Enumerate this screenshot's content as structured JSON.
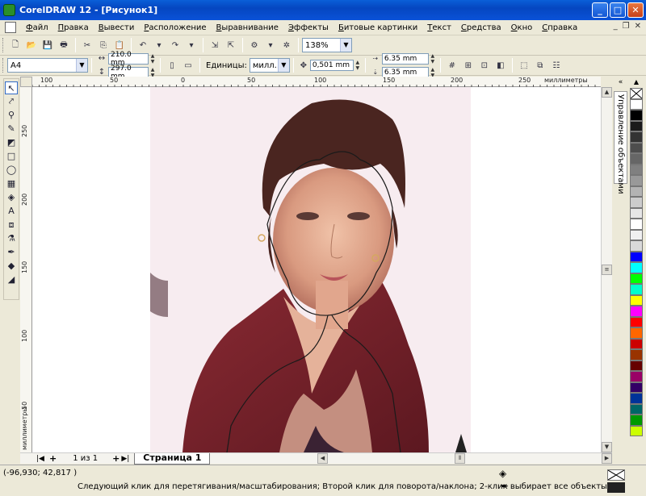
{
  "window": {
    "title": "CorelDRAW 12 - [Рисунок1]",
    "buttons": [
      "_",
      "□",
      "✕"
    ]
  },
  "menu": [
    "Файл",
    "Правка",
    "Вывести",
    "Расположение",
    "Выравнивание",
    "Эффекты",
    "Битовые картинки",
    "Текст",
    "Средства",
    "Окно",
    "Справка"
  ],
  "toolbar": {
    "zoom": "138%"
  },
  "property_bar": {
    "paper": "A4",
    "width": "210.0 mm",
    "height": "297.0 mm",
    "units_label": "Единицы:",
    "units_value": "милл...",
    "nudge": "0,501 mm",
    "dup_x": "6.35 mm",
    "dup_y": "6.35 mm"
  },
  "ruler": {
    "top_ticks": [
      "100",
      "50",
      "0",
      "50",
      "100",
      "150",
      "200",
      "250"
    ],
    "top_unit": "миллиметры",
    "left_ticks": [
      "250",
      "200",
      "150",
      "100",
      "50"
    ],
    "left_unit": "миллиметры"
  },
  "page_nav": {
    "counter": "1 из 1",
    "page_tab": "Страница 1"
  },
  "docker": {
    "label": "Управление объектами"
  },
  "palette": [
    "#ffffff",
    "#000000",
    "#1a1a1a",
    "#333333",
    "#4d4d4d",
    "#666666",
    "#808080",
    "#999999",
    "#b3b3b3",
    "#cccccc",
    "#e6e6e6",
    "#ffffff",
    "#f0f0f0",
    "#d9d9d9",
    "#0000ff",
    "#00ffff",
    "#00ff00",
    "#00ffcc",
    "#ffff00",
    "#ff00ff",
    "#ff0000",
    "#ff6600",
    "#cc0000",
    "#993300",
    "#660000",
    "#990066",
    "#330066",
    "#003399",
    "#006666",
    "#009900",
    "#ccff00"
  ],
  "status": {
    "coords": "(-96,930; 42,817 )",
    "message": "Следующий клик для перетягивания/масштабирования; Второй клик для поворота/наклона; 2-клик выбирает все объекты..."
  }
}
